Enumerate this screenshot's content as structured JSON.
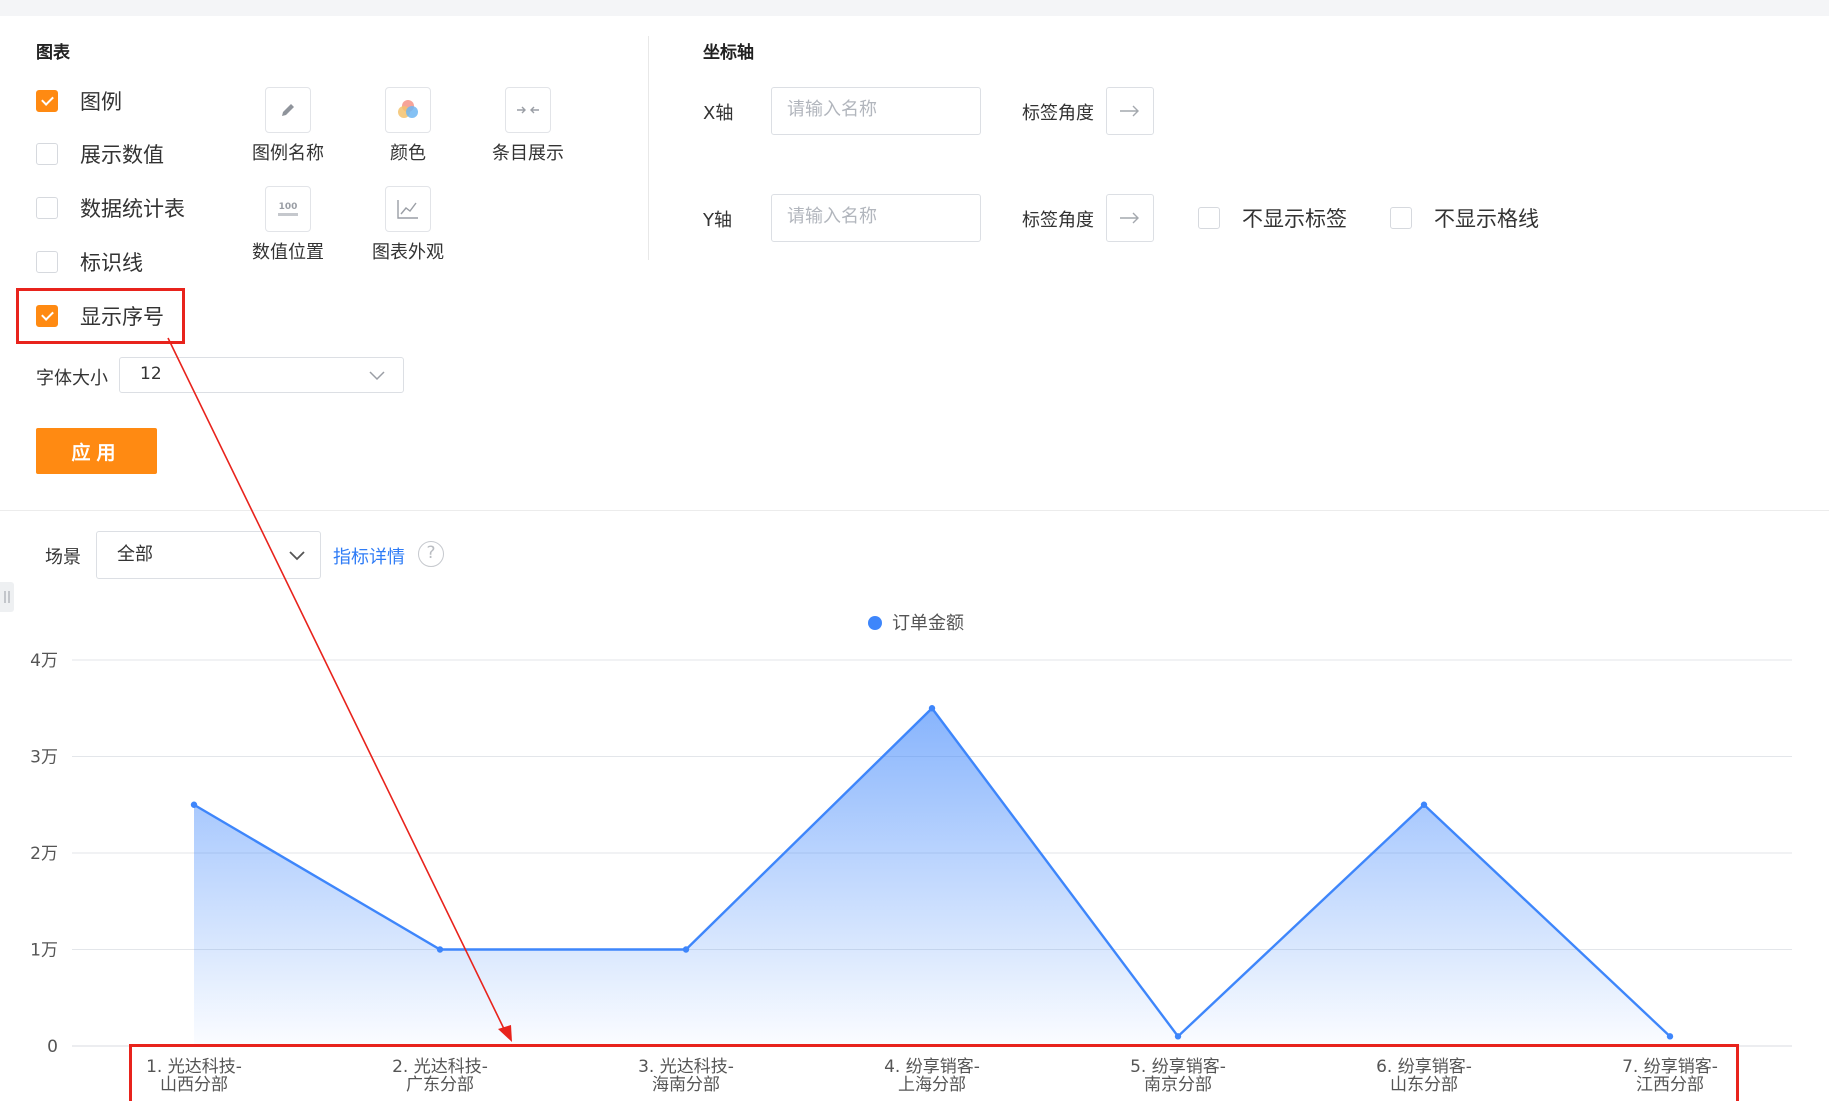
{
  "panel": {
    "chart_section_title": "图表",
    "axis_section_title": "坐标轴",
    "checkboxes": [
      {
        "label": "图例",
        "checked": true
      },
      {
        "label": "展示数值",
        "checked": false
      },
      {
        "label": "数据统计表",
        "checked": false
      },
      {
        "label": "标识线",
        "checked": false
      },
      {
        "label": "显示序号",
        "checked": true
      }
    ],
    "tools": [
      {
        "label": "图例名称",
        "icon": "pencil-icon"
      },
      {
        "label": "颜色",
        "icon": "color-palette-icon"
      },
      {
        "label": "条目展示",
        "icon": "collapse-arrows-icon"
      },
      {
        "label": "数值位置",
        "icon": "value-position-icon"
      },
      {
        "label": "图表外观",
        "icon": "line-chart-icon"
      }
    ],
    "font_size_label": "字体大小",
    "font_size_value": "12",
    "apply_label": "应用",
    "x_axis": {
      "label": "X轴",
      "placeholder": "请输入名称",
      "angle_label": "标签角度"
    },
    "y_axis": {
      "label": "Y轴",
      "placeholder": "请输入名称",
      "angle_label": "标签角度",
      "hide_labels": "不显示标签",
      "hide_grid": "不显示格线"
    }
  },
  "toolbar": {
    "scene_label": "场景",
    "scene_value": "全部",
    "detail_link": "指标详情",
    "help_glyph": "?"
  },
  "colors": {
    "accent": "#ff8a12",
    "line": "#3e86fb",
    "highlight": "#e8231c",
    "link": "#2f7cf6"
  },
  "chart_data": {
    "type": "area",
    "legend_position": "top-center",
    "grid": true,
    "ylim": [
      0,
      40000
    ],
    "y_ticks": [
      "0",
      "1万",
      "2万",
      "3万",
      "4万"
    ],
    "categories": [
      [
        "1. 光达科技-",
        "山西分部"
      ],
      [
        "2. 光达科技-",
        "广东分部"
      ],
      [
        "3. 光达科技-",
        "海南分部"
      ],
      [
        "4. 纷享销客-",
        "上海分部"
      ],
      [
        "5. 纷享销客-",
        "南京分部"
      ],
      [
        "6. 纷享销客-",
        "山东分部"
      ],
      [
        "7. 纷享销客-",
        "江西分部"
      ]
    ],
    "series": [
      {
        "name": "订单金额",
        "values": [
          25000,
          10000,
          10000,
          35000,
          1000,
          25000,
          1000
        ]
      }
    ]
  }
}
